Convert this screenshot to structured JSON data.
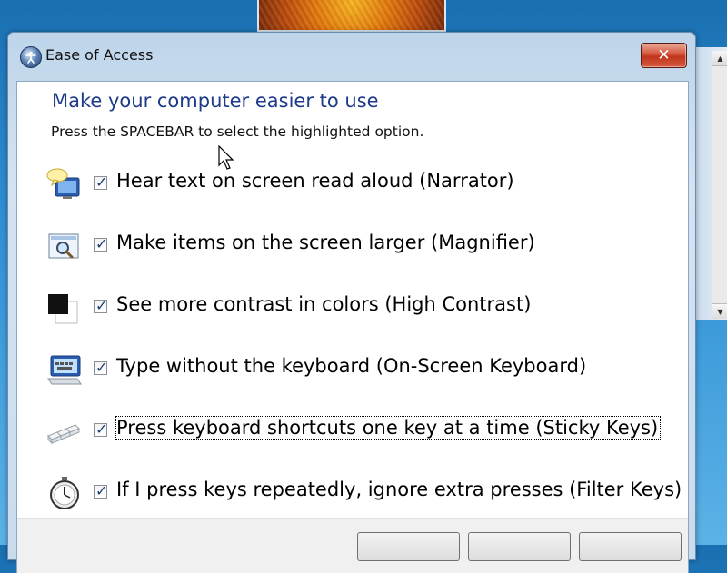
{
  "window": {
    "title": "Ease of Access",
    "close_glyph": "✕"
  },
  "main": {
    "heading": "Make your computer easier to use",
    "instruction": "Press the SPACEBAR to select the highlighted option."
  },
  "options": [
    {
      "label": "Hear text on screen read aloud (Narrator)",
      "checked": true,
      "icon": "narrator-icon"
    },
    {
      "label": "Make items on the screen larger (Magnifier)",
      "checked": true,
      "icon": "magnifier-icon"
    },
    {
      "label": "See more contrast in colors (High Contrast)",
      "checked": true,
      "icon": "high-contrast-icon"
    },
    {
      "label": "Type without the keyboard (On-Screen Keyboard)",
      "checked": true,
      "icon": "on-screen-keyboard-icon"
    },
    {
      "label": "Press keyboard shortcuts one key at a time (Sticky Keys)",
      "checked": true,
      "icon": "sticky-keys-icon",
      "focused": true
    },
    {
      "label": "If I press keys repeatedly, ignore extra presses (Filter Keys)",
      "checked": true,
      "icon": "filter-keys-icon"
    }
  ],
  "checkmark": "✓",
  "colors": {
    "heading": "#1e3a8a",
    "close_button": "#c0351d",
    "checkmark": "#1f3f7a"
  }
}
